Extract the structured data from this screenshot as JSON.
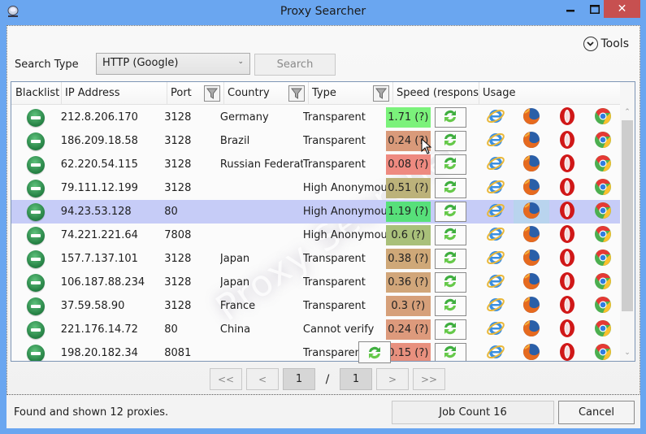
{
  "window": {
    "title": "Proxy Searcher",
    "controls": {
      "minimize": "–",
      "maximize": "☐",
      "close": "✕"
    }
  },
  "toolbar": {
    "tools_label": "Tools",
    "search_type_label": "Search Type",
    "search_type_value": "HTTP (Google)",
    "search_button": "Search"
  },
  "grid": {
    "columns": [
      "Blacklist",
      "IP Address",
      "Port",
      "Country",
      "Type",
      "Speed (respons",
      "Usage"
    ],
    "filterable_columns": [
      "Port",
      "Country",
      "Type"
    ],
    "watermark": "Proxy Searcher",
    "selected_row": 4,
    "browser_icons": [
      "internet-explorer",
      "firefox",
      "opera",
      "chrome"
    ],
    "rows": [
      {
        "ip": "212.8.206.170",
        "port": "3128",
        "country": "Germany",
        "type": "Transparent",
        "speed": "1.71 (?)",
        "speed_color": "#7bf27b"
      },
      {
        "ip": "186.209.18.58",
        "port": "3128",
        "country": "Brazil",
        "type": "Transparent",
        "speed": "0.24 (?)",
        "speed_color": "#d99a7a"
      },
      {
        "ip": "62.220.54.115",
        "port": "3128",
        "country": "Russian Federation",
        "type": "Transparent",
        "speed": "0.08 (?)",
        "speed_color": "#ee8a80"
      },
      {
        "ip": "79.111.12.199",
        "port": "3128",
        "country": "",
        "type": "High Anonymous",
        "speed": "0.51 (?)",
        "speed_color": "#bcb27a"
      },
      {
        "ip": "94.23.53.128",
        "port": "80",
        "country": "",
        "type": "High Anonymous",
        "speed": "1.19 (?)",
        "speed_color": "#57e07a"
      },
      {
        "ip": "74.221.221.64",
        "port": "7808",
        "country": "",
        "type": "High Anonymous",
        "speed": "0.6 (?)",
        "speed_color": "#a9c07a"
      },
      {
        "ip": "157.7.137.101",
        "port": "3128",
        "country": "Japan",
        "type": "Transparent",
        "speed": "0.38 (?)",
        "speed_color": "#cfa878"
      },
      {
        "ip": "106.187.88.234",
        "port": "3128",
        "country": "Japan",
        "type": "Transparent",
        "speed": "0.36 (?)",
        "speed_color": "#d1a67a"
      },
      {
        "ip": "37.59.58.90",
        "port": "3128",
        "country": "France",
        "type": "Transparent",
        "speed": "0.3 (?)",
        "speed_color": "#d6a07a"
      },
      {
        "ip": "221.176.14.72",
        "port": "80",
        "country": "China",
        "type": "Cannot verify",
        "speed": "0.24 (?)",
        "speed_color": "#dd9a7c"
      },
      {
        "ip": "198.20.182.34",
        "port": "8081",
        "country": "",
        "type": "Transparent",
        "speed": "0.15 (?)",
        "speed_color": "#e8907e"
      }
    ]
  },
  "pager": {
    "first": "<<",
    "prev": "<",
    "current_page": "1",
    "separator": "/",
    "total_pages": "1",
    "next": ">",
    "last": ">>"
  },
  "footer": {
    "status": "Found and shown 12 proxies.",
    "job_count": "Job Count 16",
    "cancel": "Cancel"
  }
}
